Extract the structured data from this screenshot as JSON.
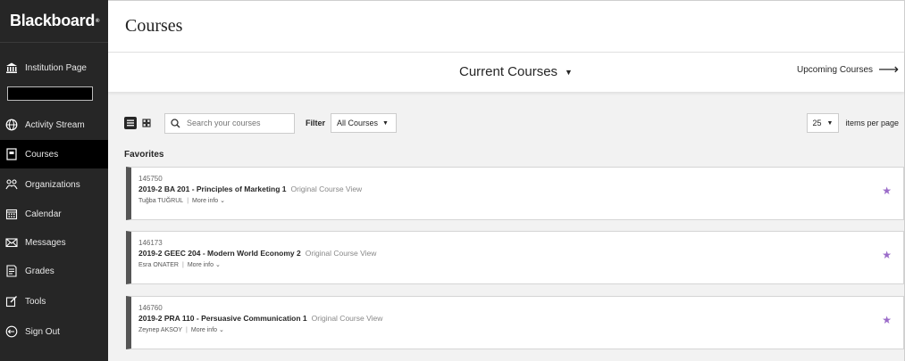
{
  "app": {
    "logo": "Blackboard",
    "logo_mark": "®"
  },
  "sidebar": {
    "items": [
      {
        "label": "Institution Page",
        "icon": "institution-icon"
      },
      {
        "label": "Activity Stream",
        "icon": "globe-icon"
      },
      {
        "label": "Courses",
        "icon": "courses-icon",
        "active": true
      },
      {
        "label": "Organizations",
        "icon": "organizations-icon"
      },
      {
        "label": "Calendar",
        "icon": "calendar-icon"
      },
      {
        "label": "Messages",
        "icon": "envelope-icon"
      },
      {
        "label": "Grades",
        "icon": "grades-icon"
      },
      {
        "label": "Tools",
        "icon": "tools-icon"
      },
      {
        "label": "Sign Out",
        "icon": "sign-out-icon"
      }
    ]
  },
  "header": {
    "title": "Courses"
  },
  "subbar": {
    "current": "Current Courses",
    "upcoming": "Upcoming Courses"
  },
  "toolbar": {
    "search_placeholder": "Search your courses",
    "filter_label": "Filter",
    "filter_value": "All Courses",
    "per_page_value": "25",
    "per_page_label": "items per page"
  },
  "favorites": {
    "title": "Favorites",
    "courses": [
      {
        "id": "145750",
        "title": "2019-2 BA 201 - Principles of Marketing 1",
        "view": "Original Course View",
        "instructor": "Tuğba TUĞRUL",
        "more": "More info"
      },
      {
        "id": "146173",
        "title": "2019-2 GEEC 204 - Modern World Economy 2",
        "view": "Original Course View",
        "instructor": "Esra ONATER",
        "more": "More info"
      },
      {
        "id": "146760",
        "title": "2019-2 PRA 110 - Persuasive Communication 1",
        "view": "Original Course View",
        "instructor": "Zeynep AKSOY",
        "more": "More info"
      }
    ]
  },
  "colors": {
    "sidebar_bg": "#262626",
    "active_bg": "#000000",
    "star": "#9b6cc9"
  }
}
